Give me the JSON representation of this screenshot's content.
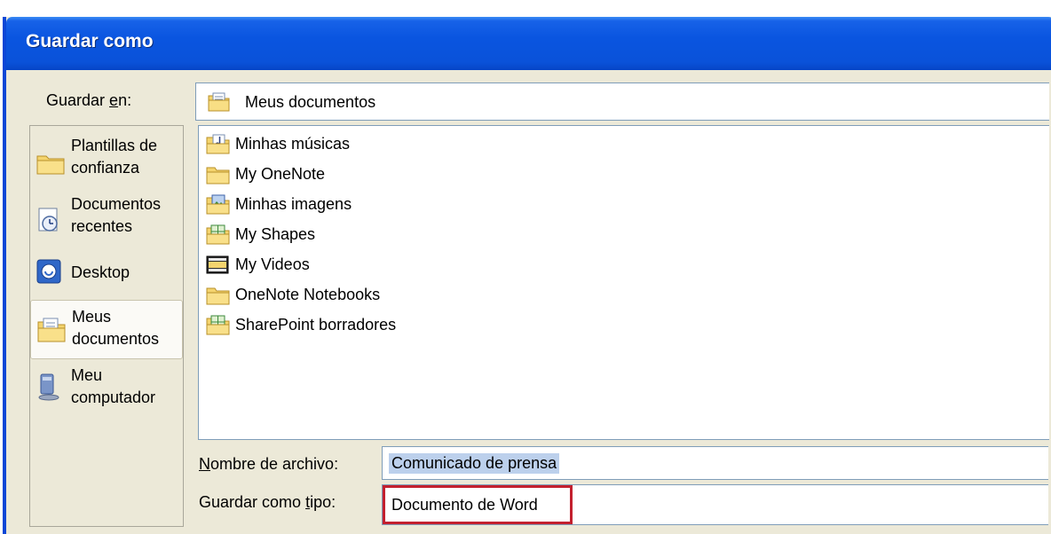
{
  "dialog": {
    "title": "Guardar como"
  },
  "save_in": {
    "label_before": "Guardar ",
    "label_accel": "e",
    "label_after": "n:",
    "value": "Meus documentos"
  },
  "places": [
    {
      "line1": "Plantillas de",
      "line2": "confianza",
      "icon": "folder-icon"
    },
    {
      "line1": "Documentos",
      "line2": "recentes",
      "icon": "recent-documents-icon"
    },
    {
      "line1": "Desktop",
      "line2": "",
      "icon": "desktop-icon"
    },
    {
      "line1": "Meus",
      "line2": "documentos",
      "icon": "my-documents-icon",
      "selected": true
    },
    {
      "line1": "Meu",
      "line2": "computador",
      "icon": "my-computer-icon"
    }
  ],
  "files": [
    {
      "name": "Minhas músicas",
      "icon": "music-folder-icon"
    },
    {
      "name": "My OneNote",
      "icon": "folder-icon"
    },
    {
      "name": "Minhas imagens",
      "icon": "pictures-folder-icon"
    },
    {
      "name": "My Shapes",
      "icon": "shapes-folder-icon"
    },
    {
      "name": "My Videos",
      "icon": "video-folder-icon"
    },
    {
      "name": "OneNote Notebooks",
      "icon": "folder-icon"
    },
    {
      "name": "SharePoint borradores",
      "icon": "sharepoint-folder-icon"
    }
  ],
  "file_name": {
    "label_accel": "N",
    "label_rest": "ombre de archivo:",
    "value": "Comunicado de prensa"
  },
  "file_type": {
    "label_before": "Guardar como ",
    "label_accel": "t",
    "label_after": "ipo:",
    "value": "Documento de Word"
  },
  "colors": {
    "title_bar": "#0a52d9",
    "highlight_box": "#c3202e",
    "selection": "#bcd0ec"
  }
}
